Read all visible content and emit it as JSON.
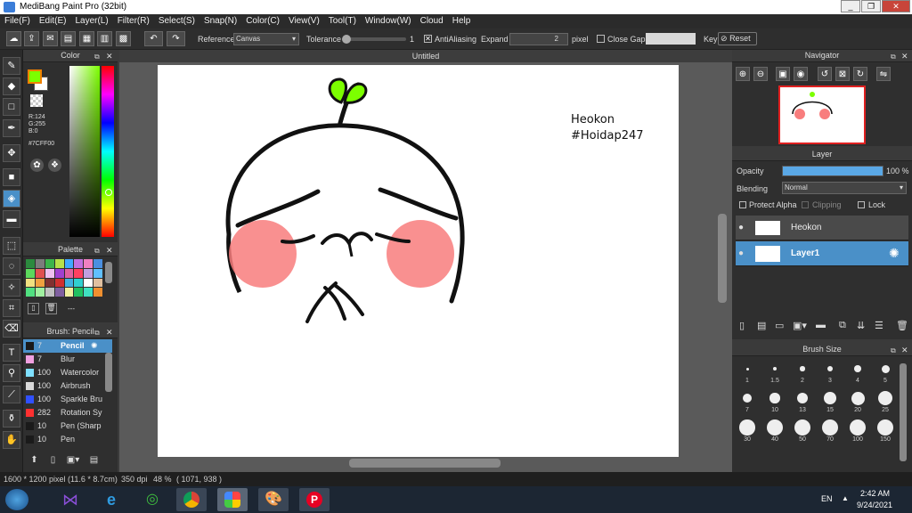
{
  "app": {
    "title": "MediBang Paint Pro (32bit)"
  },
  "menu": [
    "File(F)",
    "Edit(E)",
    "Layer(L)",
    "Filter(R)",
    "Select(S)",
    "Snap(N)",
    "Color(C)",
    "View(V)",
    "Tool(T)",
    "Window(W)",
    "Cloud",
    "Help"
  ],
  "toolbar": {
    "reference_label": "Reference",
    "reference_value": "Canvas",
    "tolerance_label": "Tolerance",
    "tolerance_value": "1",
    "antialias_label": "AntiAliasing",
    "expand_label": "Expand",
    "expand_value": "2",
    "expand_unit": "pixel",
    "close_gaps_label": "Close Gaps",
    "key_label": "Key",
    "reset_label": "Reset"
  },
  "color_panel": {
    "title": "Color",
    "r": "R:124",
    "g": "G:255",
    "b": "B:0",
    "hex": "#7CFF00",
    "fg": "#7CFF00",
    "bg": "#ffffff"
  },
  "palette_panel": {
    "title": "Palette",
    "footer": "---"
  },
  "brush_panel": {
    "title": "Brush: Pencil",
    "items": [
      {
        "size": "7",
        "name": "Pencil",
        "color": "#1a1a1a"
      },
      {
        "size": "7",
        "name": "Blur",
        "color": "#f0a0e0"
      },
      {
        "size": "100",
        "name": "Watercolor",
        "color": "#7fe0ff"
      },
      {
        "size": "100",
        "name": "Airbrush",
        "color": "#d9d9d9"
      },
      {
        "size": "100",
        "name": "Sparkle Bru",
        "color": "#3050ff"
      },
      {
        "size": "282",
        "name": "Rotation Sy",
        "color": "#ff3030"
      },
      {
        "size": "10",
        "name": "Pen (Sharp",
        "color": "#1a1a1a"
      },
      {
        "size": "10",
        "name": "Pen",
        "color": "#1a1a1a"
      }
    ]
  },
  "canvas": {
    "tab": "Untitled",
    "text1": "Heokon",
    "text2": "#Hoidap247"
  },
  "navigator": {
    "title": "Navigator"
  },
  "layer_panel": {
    "title": "Layer",
    "opacity_label": "Opacity",
    "opacity_value": "100 %",
    "opacity": 1.0,
    "blending_label": "Blending",
    "blending_value": "Normal",
    "protect_alpha": "Protect Alpha",
    "clipping": "Clipping",
    "lock": "Lock",
    "layers": [
      {
        "name": "Heokon"
      },
      {
        "name": "Layer1"
      }
    ]
  },
  "brush_size": {
    "title": "Brush Size",
    "sizes": [
      "1",
      "1.5",
      "2",
      "3",
      "4",
      "5",
      "7",
      "10",
      "13",
      "15",
      "20",
      "25",
      "30",
      "40",
      "50",
      "70",
      "100",
      "150"
    ]
  },
  "status": {
    "dims": "1600 * 1200 pixel",
    "phys": "(11.6 * 8.7cm)",
    "dpi": "350 dpi",
    "zoom": "48 %",
    "coords": "( 1071, 938 )"
  },
  "taskbar": {
    "lang": "EN",
    "time": "2:42 AM",
    "date": "9/24/2021"
  }
}
